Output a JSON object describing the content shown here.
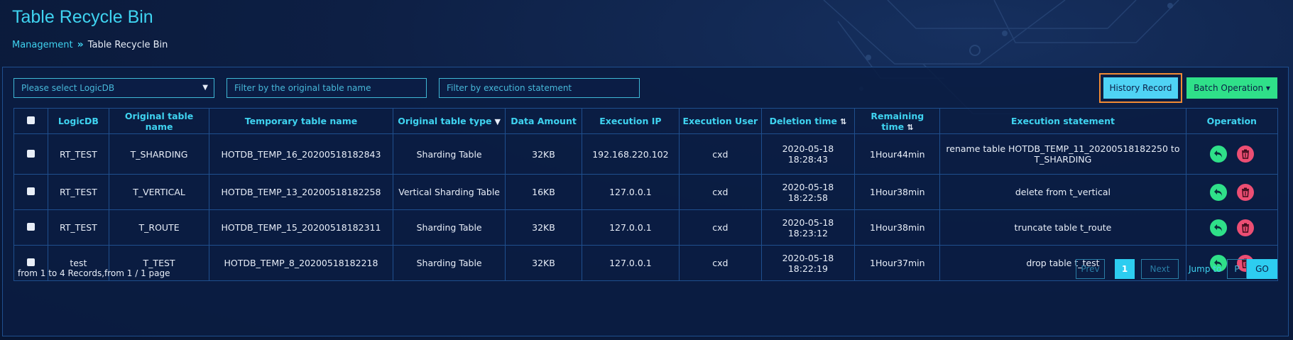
{
  "header": {
    "title": "Table Recycle Bin",
    "breadcrumb": {
      "parent": "Management",
      "separator": "»",
      "current": "Table Recycle Bin"
    }
  },
  "filters": {
    "logicdb_select": "Please select LogicDB",
    "original_table_placeholder": "Filter by the original table name",
    "execution_statement_placeholder": "Filter by execution statement"
  },
  "toolbar": {
    "history_label": "History Record",
    "batch_label": "Batch Operation ▾"
  },
  "table": {
    "columns": [
      "LogicDB",
      "Original table name",
      "Temporary table name",
      "Original table type",
      "Data Amount",
      "Execution IP",
      "Execution User",
      "Deletion time",
      "Remaining time",
      "Execution statement",
      "Operation"
    ],
    "rows": [
      {
        "logicdb": "RT_TEST",
        "original": "T_SHARDING",
        "temporary": "HOTDB_TEMP_16_20200518182843",
        "type": "Sharding Table",
        "amount": "32KB",
        "ip": "192.168.220.102",
        "user": "cxd",
        "deletion_date": "2020-05-18",
        "deletion_time": "18:28:43",
        "remaining": "1Hour44min",
        "statement": "rename table HOTDB_TEMP_11_20200518182250 to T_SHARDING"
      },
      {
        "logicdb": "RT_TEST",
        "original": "T_VERTICAL",
        "temporary": "HOTDB_TEMP_13_20200518182258",
        "type": "Vertical Sharding Table",
        "amount": "16KB",
        "ip": "127.0.0.1",
        "user": "cxd",
        "deletion_date": "2020-05-18",
        "deletion_time": "18:22:58",
        "remaining": "1Hour38min",
        "statement": "delete from t_vertical"
      },
      {
        "logicdb": "RT_TEST",
        "original": "T_ROUTE",
        "temporary": "HOTDB_TEMP_15_20200518182311",
        "type": "Sharding Table",
        "amount": "32KB",
        "ip": "127.0.0.1",
        "user": "cxd",
        "deletion_date": "2020-05-18",
        "deletion_time": "18:23:12",
        "remaining": "1Hour38min",
        "statement": "truncate table t_route"
      },
      {
        "logicdb": "test",
        "original": "T_TEST",
        "temporary": "HOTDB_TEMP_8_20200518182218",
        "type": "Sharding Table",
        "amount": "32KB",
        "ip": "127.0.0.1",
        "user": "cxd",
        "deletion_date": "2020-05-18",
        "deletion_time": "18:22:19",
        "remaining": "1Hour37min",
        "statement": "drop table t_test"
      }
    ]
  },
  "footer": {
    "records_text": "from 1 to 4 Records,from 1 / 1 page",
    "prev": "Prev",
    "current_page": "1",
    "next": "Next",
    "jump_label": "Jump to",
    "jump_placeholder": "P",
    "go": "GO"
  },
  "colors": {
    "accent_cyan": "#3fd3f0",
    "restore_green": "#2fe089",
    "delete_red": "#ec4e73",
    "highlight_orange": "#f08a34"
  }
}
